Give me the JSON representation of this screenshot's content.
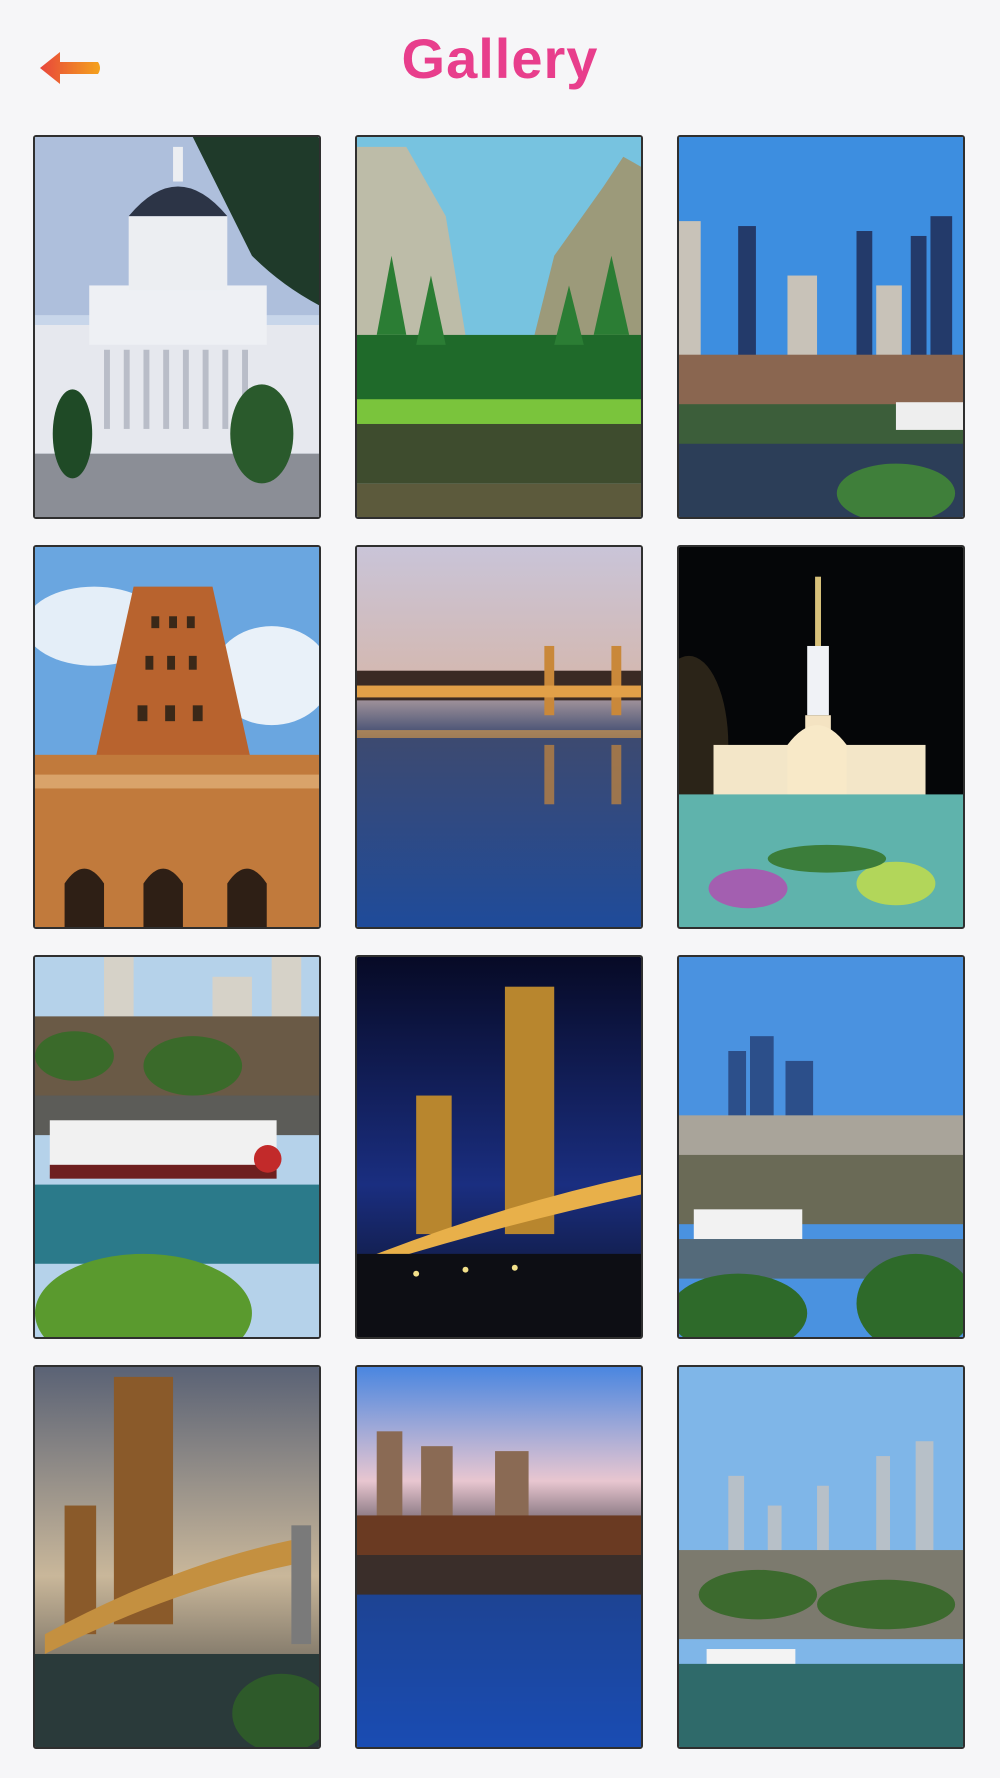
{
  "header": {
    "title": "Gallery",
    "back_icon": "back-arrow-icon",
    "title_color": "#e83e8c",
    "back_gradient": [
      "#f4a21c",
      "#e8463c"
    ]
  },
  "gallery": {
    "columns": 3,
    "items": [
      {
        "name": "capitol-building",
        "theme": "capitol"
      },
      {
        "name": "yosemite-valley",
        "theme": "valley"
      },
      {
        "name": "skyline-river-day",
        "theme": "skyline-day"
      },
      {
        "name": "brick-tower-building",
        "theme": "brick-tower"
      },
      {
        "name": "tower-bridge-dusk",
        "theme": "bridge-dusk"
      },
      {
        "name": "temple-at-night",
        "theme": "temple-night"
      },
      {
        "name": "riverboat-marina",
        "theme": "riverboat"
      },
      {
        "name": "tower-bridge-night",
        "theme": "bridge-night"
      },
      {
        "name": "city-skyline-marina",
        "theme": "skyline-marina"
      },
      {
        "name": "tower-bridge-sunset",
        "theme": "bridge-sunset"
      },
      {
        "name": "city-night-reflection",
        "theme": "city-night"
      },
      {
        "name": "downtown-waterfront",
        "theme": "downtown"
      }
    ]
  }
}
